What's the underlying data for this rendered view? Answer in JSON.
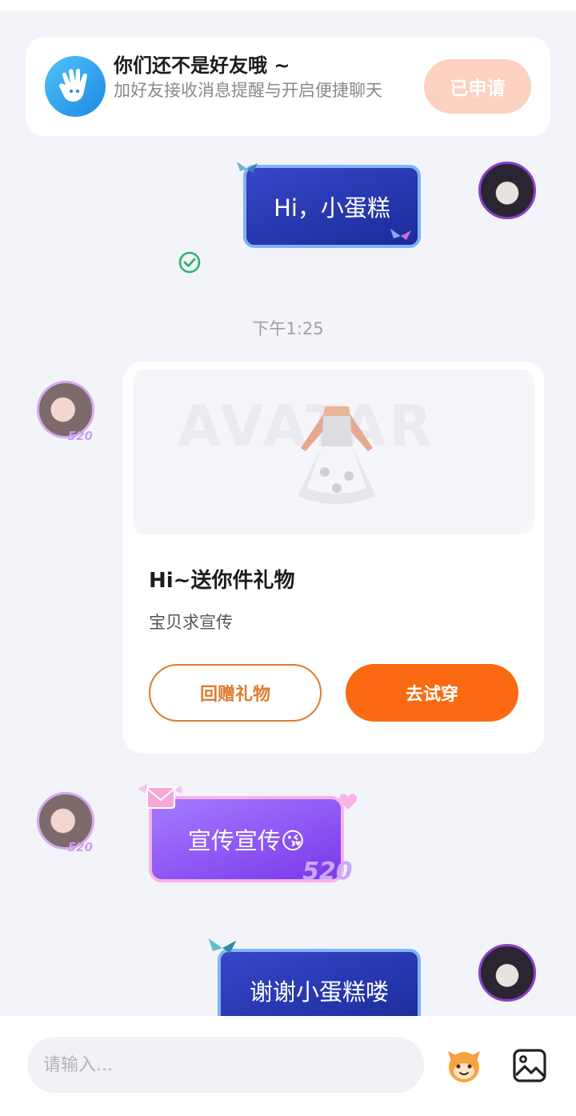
{
  "friend_banner": {
    "title": "你们还不是好友哦 ~",
    "subtitle": "加好友接收消息提醒与开启便捷聊天",
    "button_label": "已申请",
    "icon": "hand-wave-icon"
  },
  "messages": [
    {
      "side": "right",
      "text": "Hi，小蛋糕",
      "status_icon": "check-circle-icon"
    },
    {
      "timestamp": "下午1:25"
    },
    {
      "side": "left",
      "gift_card": {
        "image_watermark": "AVATAR",
        "title": "Hi~送你件礼物",
        "description": "宝贝求宣传",
        "secondary_button": "回赠礼物",
        "primary_button": "去试穿"
      }
    },
    {
      "side": "left",
      "text": "宣传宣传😘",
      "badge": "520"
    },
    {
      "side": "right",
      "text": "谢谢小蛋糕喽"
    }
  ],
  "avatar_badge": "520",
  "input": {
    "placeholder": "请输入...",
    "value": ""
  },
  "colors": {
    "accent_orange": "#fb6a12",
    "applied_button": "#fdd1bf",
    "blue_bubble": "#2a3bb8",
    "purple_bubble": "#8a4ff0"
  }
}
